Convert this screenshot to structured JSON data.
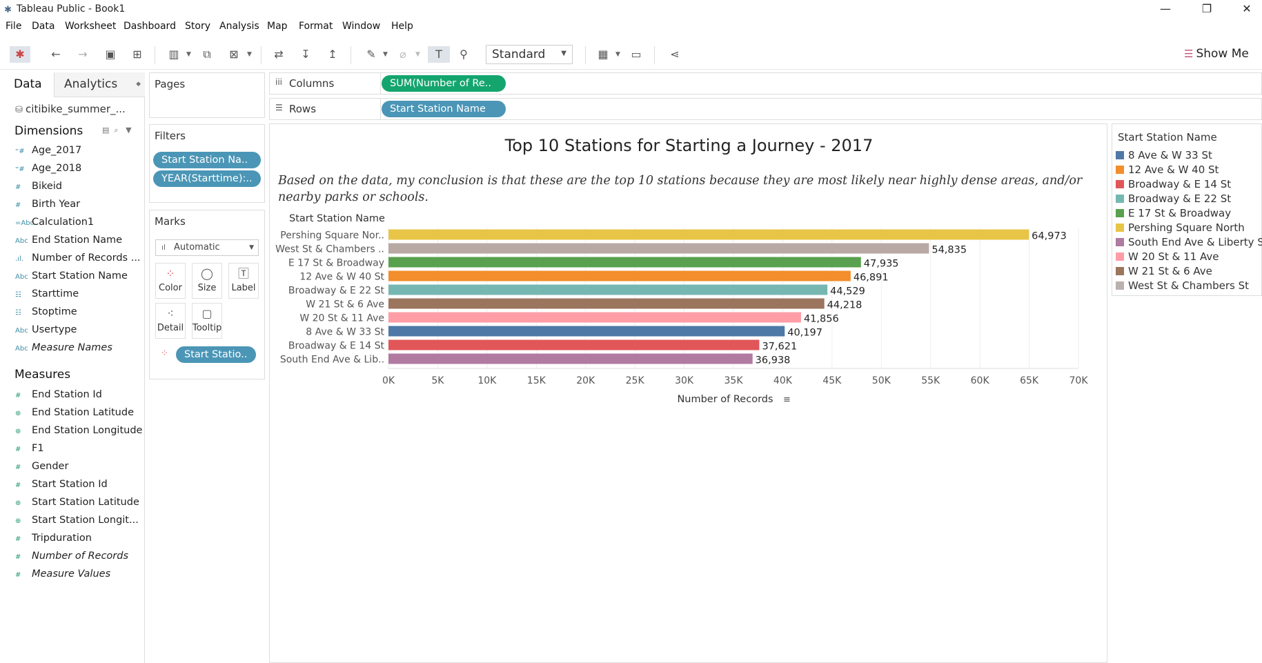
{
  "window": {
    "title": "Tableau Public - Book1"
  },
  "menu": [
    "File",
    "Data",
    "Worksheet",
    "Dashboard",
    "Story",
    "Analysis",
    "Map",
    "Format",
    "Window",
    "Help"
  ],
  "toolbar": {
    "fit_select": "Standard",
    "show_me": "Show Me"
  },
  "data_pane": {
    "tabs": {
      "data": "Data",
      "analytics": "Analytics"
    },
    "datasource": "citibike_summer_...",
    "dimensions_title": "Dimensions",
    "dimensions": [
      {
        "icon": "⁼#",
        "label": "Age_2017"
      },
      {
        "icon": "⁼#",
        "label": "Age_2018"
      },
      {
        "icon": "#",
        "label": "Bikeid"
      },
      {
        "icon": "#",
        "label": "Birth Year"
      },
      {
        "icon": "=Abc",
        "label": "Calculation1"
      },
      {
        "icon": "Abc",
        "label": "End Station Name"
      },
      {
        "icon": ".ıl.",
        "label": "Number of Records ..."
      },
      {
        "icon": "Abc",
        "label": "Start Station Name"
      },
      {
        "icon": "☷",
        "label": "Starttime"
      },
      {
        "icon": "☷",
        "label": "Stoptime"
      },
      {
        "icon": "Abc",
        "label": "Usertype"
      },
      {
        "icon": "Abc",
        "label": "Measure Names"
      }
    ],
    "measures_title": "Measures",
    "measures": [
      {
        "icon": "#",
        "label": "End Station Id"
      },
      {
        "icon": "⊕",
        "label": "End Station Latitude"
      },
      {
        "icon": "⊕",
        "label": "End Station Longitude"
      },
      {
        "icon": "#",
        "label": "F1"
      },
      {
        "icon": "#",
        "label": "Gender"
      },
      {
        "icon": "#",
        "label": "Start Station Id"
      },
      {
        "icon": "⊕",
        "label": "Start Station Latitude"
      },
      {
        "icon": "⊕",
        "label": "Start Station Longit..."
      },
      {
        "icon": "#",
        "label": "Tripduration"
      },
      {
        "icon": "#",
        "label": "Number of Records"
      },
      {
        "icon": "#",
        "label": "Measure Values"
      }
    ]
  },
  "cards": {
    "pages": "Pages",
    "filters": "Filters",
    "filter_pills": [
      "Start Station Na..",
      "YEAR(Starttime):.."
    ],
    "marks": "Marks",
    "marks_type": "Automatic",
    "mark_buttons": [
      "Color",
      "Size",
      "Label",
      "Detail",
      "Tooltip"
    ],
    "marks_pill": "Start Statio.."
  },
  "shelves": {
    "columns_label": "Columns",
    "columns_pill": "SUM(Number of Re..",
    "rows_label": "Rows",
    "rows_pill": "Start Station Name"
  },
  "sheet": {
    "title": "Top 10 Stations for Starting a Journey - 2017",
    "caption": "Based on the data, my conclusion is that these are the top 10 stations because they are most likely near highly dense areas, and/or nearby parks or schools."
  },
  "chart_data": {
    "type": "bar",
    "orientation": "horizontal",
    "row_header": "Start Station Name",
    "xlabel": "Number of Records",
    "xlim": [
      0,
      70000
    ],
    "x_ticks": [
      "0K",
      "5K",
      "10K",
      "15K",
      "20K",
      "25K",
      "30K",
      "35K",
      "40K",
      "45K",
      "50K",
      "55K",
      "60K",
      "65K",
      "70K"
    ],
    "grid": "vertical gridlines",
    "categories": [
      "Pershing Square Nor..",
      "West St & Chambers ..",
      "E 17 St & Broadway",
      "12 Ave & W 40 St",
      "Broadway & E 22 St",
      "W 21 St & 6 Ave",
      "W 20 St & 11 Ave",
      "8 Ave & W 33 St",
      "Broadway & E 14 St",
      "South End Ave & Lib.."
    ],
    "values": [
      64973,
      54835,
      47935,
      46891,
      44529,
      44218,
      41856,
      40197,
      37621,
      36938
    ],
    "value_labels": [
      "64,973",
      "54,835",
      "47,935",
      "46,891",
      "44,529",
      "44,218",
      "41,856",
      "40,197",
      "37,621",
      "36,938"
    ],
    "colors": [
      "#e8c547",
      "#b9a9a4",
      "#59a14f",
      "#f28e2b",
      "#76b7b2",
      "#9c755f",
      "#ff9da7",
      "#4e79a7",
      "#e15759",
      "#b07aa1"
    ]
  },
  "legend": {
    "title": "Start Station Name",
    "items": [
      {
        "label": "8 Ave & W 33 St",
        "color": "#4e79a7"
      },
      {
        "label": "12 Ave & W 40 St",
        "color": "#f28e2b"
      },
      {
        "label": "Broadway & E 14 St",
        "color": "#e15759"
      },
      {
        "label": "Broadway & E 22 St",
        "color": "#76b7b2"
      },
      {
        "label": "E 17 St & Broadway",
        "color": "#59a14f"
      },
      {
        "label": "Pershing Square North",
        "color": "#e8c547"
      },
      {
        "label": "South End Ave & Liberty St",
        "color": "#b07aa1"
      },
      {
        "label": "W 20 St & 11 Ave",
        "color": "#ff9da7"
      },
      {
        "label": "W 21 St & 6 Ave",
        "color": "#9c755f"
      },
      {
        "label": "West St & Chambers St",
        "color": "#bab0ac"
      }
    ]
  }
}
